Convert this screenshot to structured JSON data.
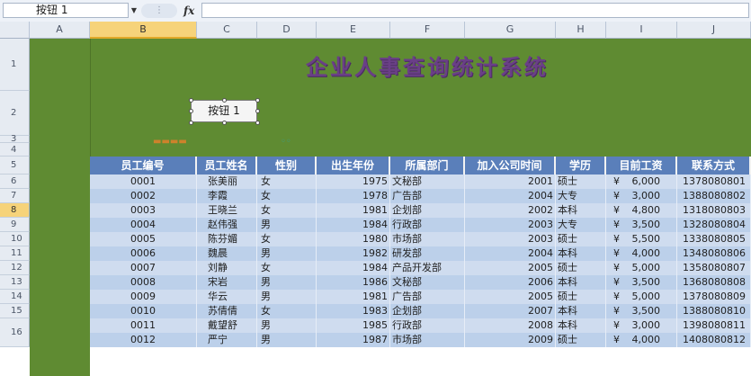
{
  "formula_bar": {
    "name_box": "按钮 1",
    "fx_label": "fx",
    "formula": ""
  },
  "columns": [
    {
      "label": "A",
      "active": false
    },
    {
      "label": "B",
      "active": true
    },
    {
      "label": "C",
      "active": false
    },
    {
      "label": "D",
      "active": false
    },
    {
      "label": "E",
      "active": false
    },
    {
      "label": "F",
      "active": false
    },
    {
      "label": "G",
      "active": false
    },
    {
      "label": "H",
      "active": false
    },
    {
      "label": "I",
      "active": false
    },
    {
      "label": "J",
      "active": false
    }
  ],
  "rows": [
    "1",
    "2",
    "3",
    "4",
    "5",
    "6",
    "7",
    "8",
    "9",
    "10",
    "11",
    "12",
    "13",
    "14",
    "15",
    "16"
  ],
  "active_row": "8",
  "sheet": {
    "title": "企业人事查询统计系统",
    "button_label": "按钮 1",
    "currency_symbol": "¥"
  },
  "table": {
    "headers": [
      "员工编号",
      "员工姓名",
      "性别",
      "出生年份",
      "所属部门",
      "加入公司时间",
      "学历",
      "目前工资",
      "联系方式"
    ],
    "rows": [
      [
        "0001",
        "张美丽",
        "女",
        "1975",
        "文秘部",
        "2001",
        "硕士",
        "6,000",
        "1378080801"
      ],
      [
        "0002",
        "李霞",
        "女",
        "1978",
        "广告部",
        "2004",
        "大专",
        "3,000",
        "1388080802"
      ],
      [
        "0003",
        "王晓兰",
        "女",
        "1981",
        "企划部",
        "2002",
        "本科",
        "4,800",
        "1318080803"
      ],
      [
        "0004",
        "赵伟强",
        "男",
        "1984",
        "行政部",
        "2003",
        "大专",
        "3,500",
        "1328080804"
      ],
      [
        "0005",
        "陈芬媚",
        "女",
        "1980",
        "市场部",
        "2003",
        "硕士",
        "5,500",
        "1338080805"
      ],
      [
        "0006",
        "魏晨",
        "男",
        "1982",
        "研发部",
        "2004",
        "本科",
        "4,000",
        "1348080806"
      ],
      [
        "0007",
        "刘静",
        "女",
        "1984",
        "产品开发部",
        "2005",
        "硕士",
        "5,000",
        "1358080807"
      ],
      [
        "0008",
        "宋岩",
        "男",
        "1986",
        "文秘部",
        "2006",
        "本科",
        "3,500",
        "1368080808"
      ],
      [
        "0009",
        "华云",
        "男",
        "1981",
        "广告部",
        "2005",
        "硕士",
        "5,000",
        "1378080809"
      ],
      [
        "0010",
        "苏倩倩",
        "女",
        "1983",
        "企划部",
        "2007",
        "本科",
        "3,500",
        "1388080810"
      ],
      [
        "0011",
        "戴望舒",
        "男",
        "1985",
        "行政部",
        "2008",
        "本科",
        "3,000",
        "1398080811"
      ],
      [
        "0012",
        "严宁",
        "男",
        "1987",
        "市场部",
        "2009",
        "硕士",
        "4,000",
        "1408080812"
      ]
    ]
  },
  "colors": {
    "green_fill": "#5f8b32",
    "header_blue": "#5a7fba",
    "title_purple": "#6a3f87",
    "row_light": "#cfdcef",
    "row_dark": "#bcd0ea"
  }
}
